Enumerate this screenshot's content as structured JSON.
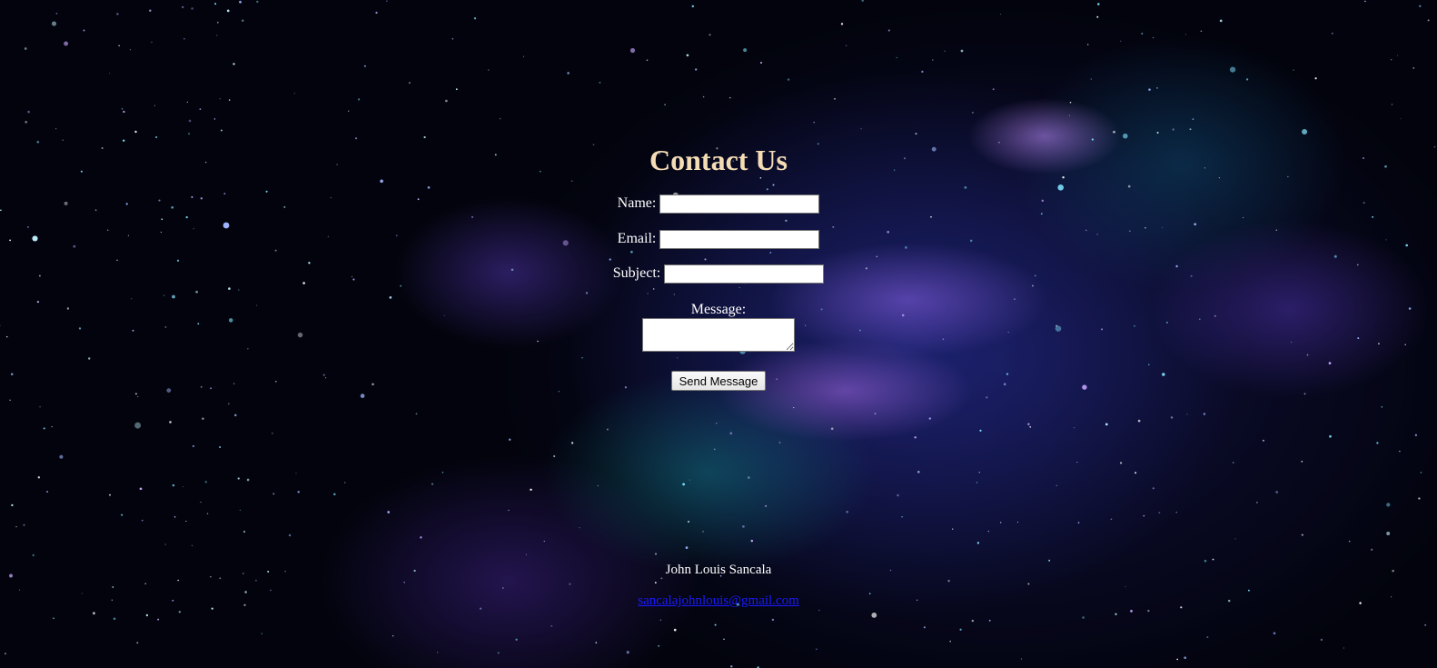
{
  "page": {
    "title": "Contact Us"
  },
  "form": {
    "name_label": "Name:",
    "name_value": "",
    "email_label": "Email:",
    "email_value": "",
    "subject_label": "Subject:",
    "subject_value": "",
    "message_label": "Message:",
    "message_value": "",
    "submit_label": "Send Message"
  },
  "footer": {
    "author": "John Louis Sancala",
    "email": "sancalajohnlouis@gmail.com"
  },
  "colors": {
    "title": "#f4dcb4",
    "text": "#ffffff",
    "link": "#1a1aff",
    "background": "#02030c"
  }
}
